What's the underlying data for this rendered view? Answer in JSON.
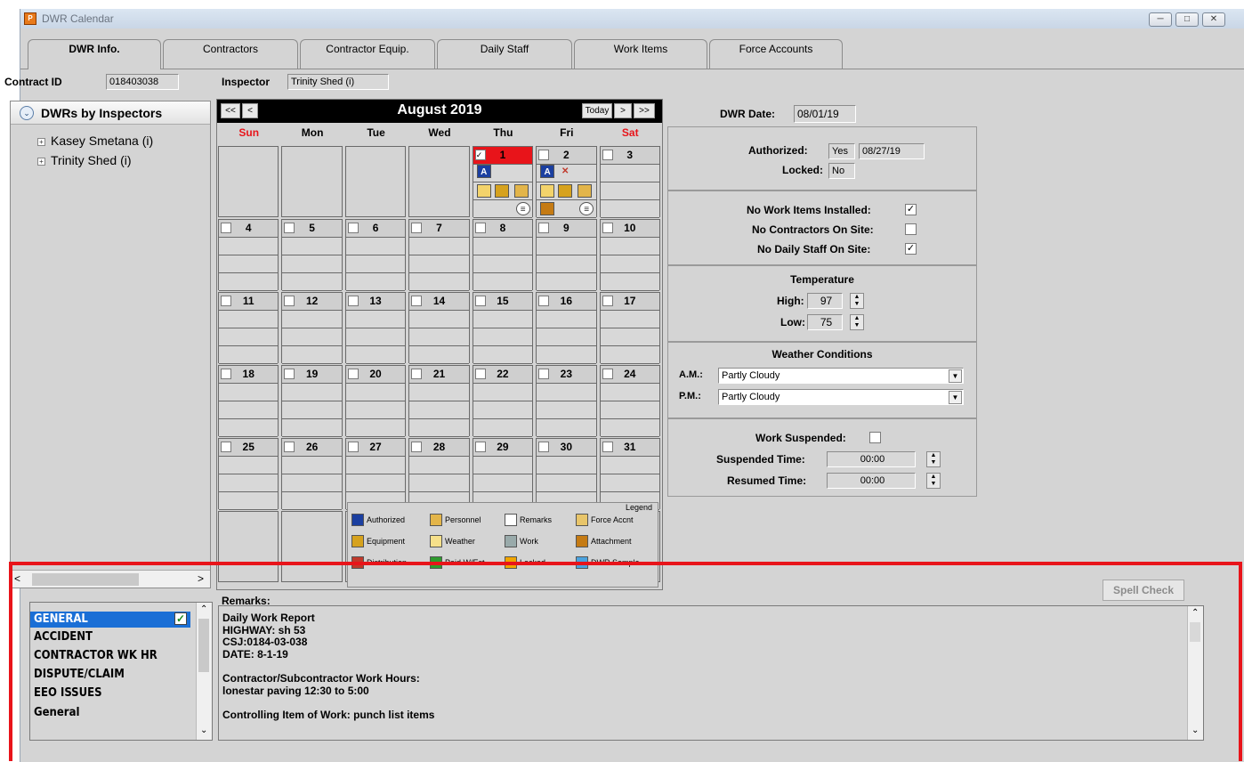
{
  "window": {
    "title": "DWR Calendar",
    "buttons": [
      "minimize",
      "restore",
      "close"
    ]
  },
  "tabs": [
    {
      "label": "DWR Info.",
      "active": true
    },
    {
      "label": "Contractors"
    },
    {
      "label": "Contractor Equip."
    },
    {
      "label": "Daily Staff"
    },
    {
      "label": "Work Items"
    },
    {
      "label": "Force Accounts"
    }
  ],
  "contract": {
    "label": "Contract ID",
    "value": "018403038"
  },
  "inspector": {
    "label": "Inspector",
    "value": "Trinity Shed (i)"
  },
  "tree": {
    "header": "DWRs by Inspectors",
    "items": [
      "Kasey Smetana (i)",
      "Trinity Shed (i)"
    ],
    "scroll_left": "<",
    "scroll_right": ">"
  },
  "calendar": {
    "nav_prev2": "<<",
    "nav_prev": "<",
    "month": "August 2019",
    "today": "Today",
    "nav_next": ">",
    "nav_next2": ">>",
    "weekdays": [
      "Sun",
      "Mon",
      "Tue",
      "Wed",
      "Thu",
      "Fri",
      "Sat"
    ],
    "days": [
      "1",
      "2",
      "3",
      "4",
      "5",
      "6",
      "7",
      "8",
      "9",
      "10",
      "11",
      "12",
      "13",
      "14",
      "15",
      "16",
      "17",
      "18",
      "19",
      "20",
      "21",
      "22",
      "23",
      "24",
      "25",
      "26",
      "27",
      "28",
      "29",
      "30",
      "31"
    ],
    "legend_title": "Legend",
    "legend": [
      "Authorized",
      "Personnel",
      "Remarks",
      "Force Accnt",
      "Equipment",
      "Weather",
      "Work",
      "Attachment",
      "Distribution",
      "Paid W/Est",
      "Locked",
      "DWR Sample"
    ]
  },
  "dwr_date": {
    "label": "DWR Date:",
    "value": "08/01/19"
  },
  "status": {
    "authorized_label": "Authorized:",
    "authorized_value": "Yes",
    "authorized_date": "08/27/19",
    "locked_label": "Locked:",
    "locked_value": "No"
  },
  "flags": {
    "no_work_items_label": "No Work Items Installed:",
    "no_work_items": true,
    "no_contractors_label": "No Contractors On Site:",
    "no_contractors": false,
    "no_daily_staff_label": "No Daily Staff On Site:",
    "no_daily_staff": true
  },
  "temperature": {
    "title": "Temperature",
    "high_label": "High:",
    "high": "97",
    "low_label": "Low:",
    "low": "75"
  },
  "weather": {
    "title": "Weather Conditions",
    "am_label": "A.M.:",
    "am": "Partly Cloudy",
    "pm_label": "P.M.:",
    "pm": "Partly Cloudy"
  },
  "suspension": {
    "work_suspended_label": "Work Suspended:",
    "work_suspended": false,
    "suspended_label": "Suspended Time:",
    "suspended_time": "00:00",
    "resumed_label": "Resumed Time:",
    "resumed_time": "00:00"
  },
  "remarks": {
    "label": "Remarks:",
    "spell_check": "Spell Check",
    "categories": [
      "GENERAL",
      "ACCIDENT",
      "CONTRACTOR WK HR",
      "DISPUTE/CLAIM",
      "EEO ISSUES",
      "General"
    ],
    "selected": "GENERAL",
    "lines": [
      "Daily Work Report",
      "HIGHWAY:  sh 53",
      "CSJ:0184-03-038",
      "DATE: 8-1-19",
      "",
      "Contractor/Subcontractor Work Hours:",
      "lonestar paving 12:30 to 5:00",
      "",
      "Controlling Item of Work:  punch list items"
    ]
  },
  "colors": {
    "highlight_box": "#e8141a",
    "weekend": "#e8141a",
    "selection": "#1a6fd6",
    "calendar_header": "#000000"
  }
}
